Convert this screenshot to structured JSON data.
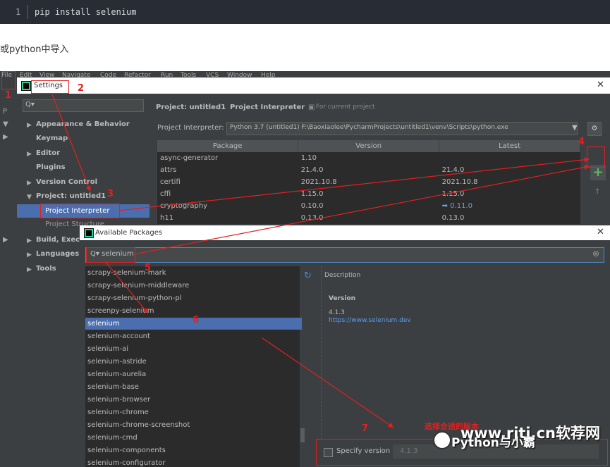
{
  "code_block": {
    "line_number": "1",
    "code": "pip install selenium"
  },
  "intro_text": "或python中导入",
  "ide": {
    "menu": [
      "File",
      "Edit",
      "View",
      "Navigate",
      "Code",
      "Refactor",
      "Run",
      "Tools",
      "VCS",
      "Window",
      "Help"
    ],
    "gutter": [
      "P",
      "▼",
      "▶",
      "▶"
    ]
  },
  "settings": {
    "title": "Settings",
    "search_placeholder": "Q▾",
    "tree": [
      {
        "label": "Appearance & Behavior",
        "arrow": "▶"
      },
      {
        "label": "Keymap",
        "arrow": ""
      },
      {
        "label": "Editor",
        "arrow": "▶"
      },
      {
        "label": "Plugins",
        "arrow": ""
      },
      {
        "label": "Version Control",
        "arrow": "▶"
      },
      {
        "label": "Project: untitled1",
        "arrow": "▼"
      },
      {
        "label": "Project Interpreter",
        "arrow": ""
      },
      {
        "label": "Project Structure",
        "arrow": ""
      },
      {
        "label": "Build, Execu",
        "arrow": "▶"
      },
      {
        "label": "Languages &",
        "arrow": "▶"
      },
      {
        "label": "Tools",
        "arrow": "▶"
      }
    ],
    "breadcrumb": {
      "project": "Project: untitled1",
      "sep": "›",
      "page": "Project Interpreter",
      "scope": "For current project"
    },
    "interpreter_label": "Project Interpreter:",
    "interpreter_value": "Python 3.7 (untitled1) F:\\Baoxiaolee\\PycharmProjects\\untitled1\\venv\\Scripts\\python.exe",
    "table": {
      "headers": [
        "Package",
        "Version",
        "Latest"
      ],
      "rows": [
        [
          "async-generator",
          "1.10",
          ""
        ],
        [
          "attrs",
          "21.4.0",
          "21.4.0"
        ],
        [
          "certifi",
          "2021.10.8",
          "2021.10.8"
        ],
        [
          "cffi",
          "1.15.0",
          "1.15.0"
        ],
        [
          "cryptography",
          "0.10.0",
          "➡ 0.11.0"
        ],
        [
          "h11",
          "0.13.0",
          "0.13.0"
        ]
      ]
    },
    "add_button": "+",
    "up_button": "↑"
  },
  "available": {
    "title": "Available Packages",
    "search_value": "Q▾ selenium",
    "packages": [
      "scrapy-selenium-mark",
      "scrapy-selenium-middleware",
      "scrapy-selenium-python-pl",
      "screenpy-selenium",
      "selenium",
      "selenium-account",
      "selenium-ai",
      "selenium-astride",
      "selenium-aurelia",
      "selenium-base",
      "selenium-browser",
      "selenium-chrome",
      "selenium-chrome-screenshot",
      "selenium-cmd",
      "selenium-components",
      "selenium-configurator"
    ],
    "selected_index": 4,
    "description_label": "Description",
    "version_label": "Version",
    "version_value": "4.1.3",
    "link": "https://www.selenium.dev",
    "specify_version_label": "Specify version",
    "specify_version_value": "4.1.3"
  },
  "annotations": {
    "numbers": [
      "1",
      "2",
      "3",
      "4",
      "5",
      "6",
      "7"
    ],
    "note": "选择合适的版本"
  },
  "watermarks": {
    "site": "www.rjtj.cn软荐网",
    "account": "Python与小霸"
  },
  "colors": {
    "accent_red": "#e32020",
    "selection_blue": "#4b6eaf",
    "add_green": "#5fb85f",
    "ide_bg": "#3c3f41"
  }
}
